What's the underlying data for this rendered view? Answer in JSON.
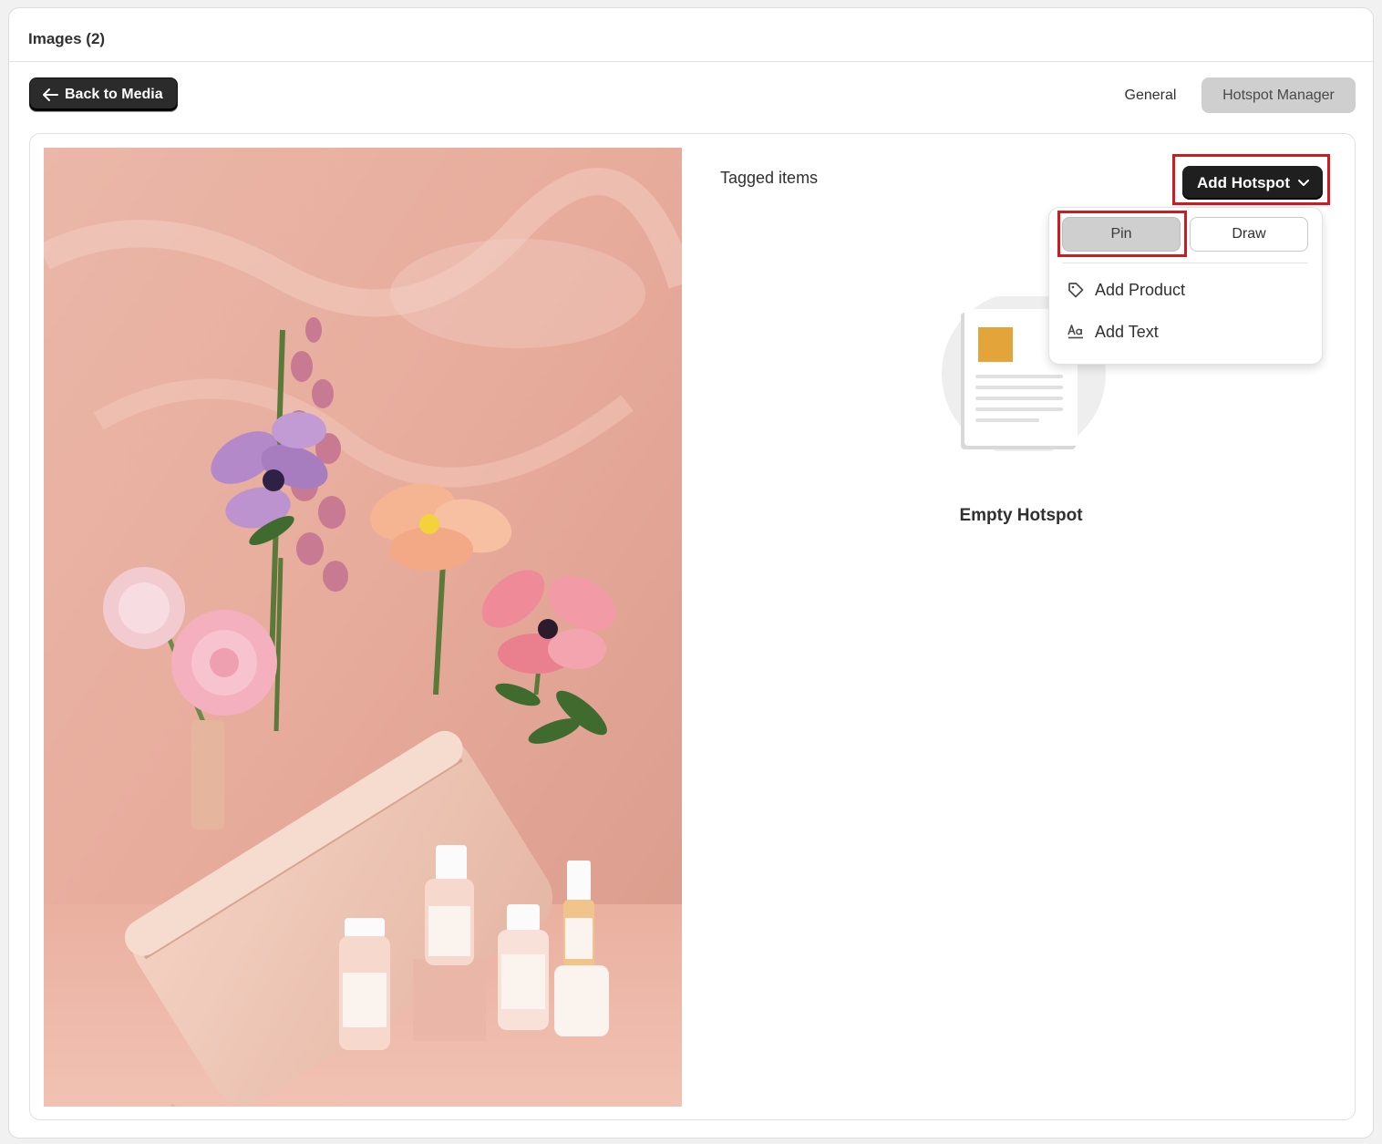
{
  "header": {
    "title": "Images (2)"
  },
  "toolbar": {
    "back_label": "Back to Media"
  },
  "tabs": [
    {
      "label": "General",
      "active": false
    },
    {
      "label": "Hotspot Manager",
      "active": true
    }
  ],
  "tagged": {
    "title": "Tagged items"
  },
  "add_hotspot": {
    "label": "Add Hotspot",
    "icon": "chevron-down-icon"
  },
  "popover": {
    "modes": [
      {
        "label": "Pin",
        "selected": true
      },
      {
        "label": "Draw",
        "selected": false
      }
    ],
    "items": [
      {
        "label": "Add Product",
        "icon": "tag-icon"
      },
      {
        "label": "Add Text",
        "icon": "text-format-icon"
      }
    ]
  },
  "empty_state": {
    "label": "Empty Hotspot"
  },
  "colors": {
    "highlight": "#d2191f",
    "primary_button": "#1f1f1f",
    "tab_active": "#cfcfcf"
  }
}
